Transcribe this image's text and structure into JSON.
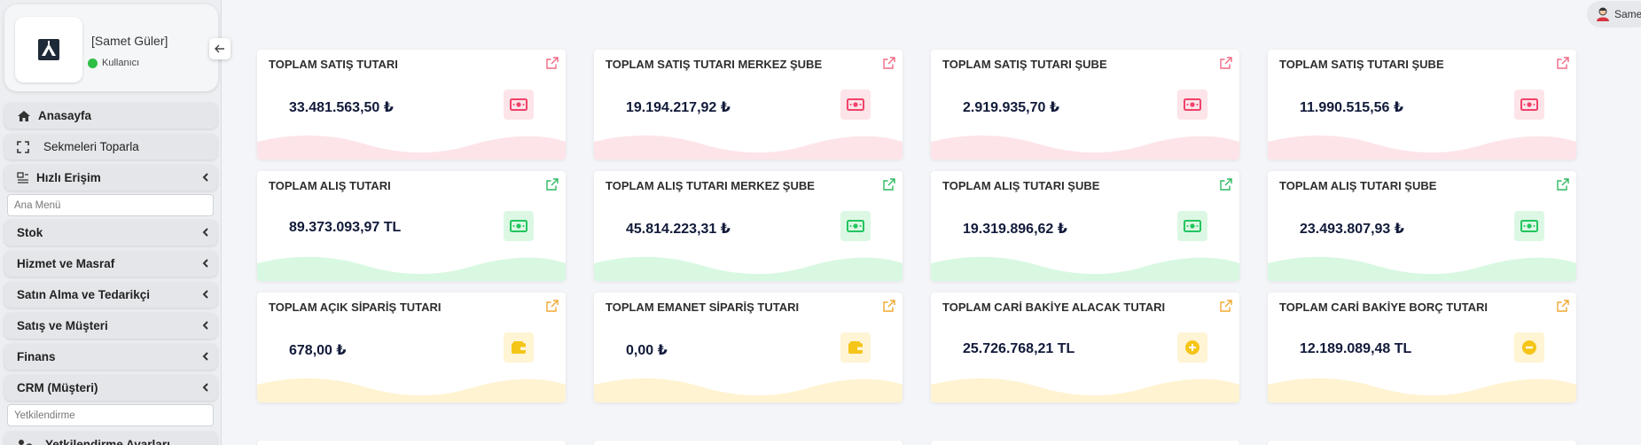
{
  "sidebar": {
    "user_name": "[Samet Güler]",
    "user_role": "Kullanıcı",
    "home_label": "Anasayfa",
    "tabs_label": "Sekmeleri Toparla",
    "quick_label": "Hızlı Erişim",
    "menu_placeholder": "Ana Menü",
    "items": [
      "Stok",
      "Hizmet ve Masraf",
      "Satın Alma ve Tedarikçi",
      "Satış ve Müşteri",
      "Finans",
      "CRM (Müşteri)"
    ],
    "auth_placeholder": "Yetkilendirme",
    "auth_settings_label": "Yetkilendirme Ayarları"
  },
  "header": {
    "user_chip": "Same"
  },
  "cards": [
    {
      "title": "TOPLAM SATIŞ TUTARI",
      "value": "33.481.563,50 ₺",
      "tone": "red",
      "icon": "cash-icon"
    },
    {
      "title": "TOPLAM SATIŞ TUTARI MERKEZ ŞUBE",
      "value": "19.194.217,92 ₺",
      "tone": "red",
      "icon": "cash-icon"
    },
    {
      "title": "TOPLAM SATIŞ TUTARI           ŞUBE",
      "value": "2.919.935,70 ₺",
      "tone": "red",
      "icon": "cash-icon"
    },
    {
      "title": "TOPLAM SATIŞ TUTARI        ŞUBE",
      "value": "11.990.515,56 ₺",
      "tone": "red",
      "icon": "cash-icon"
    },
    {
      "title": "TOPLAM ALIŞ TUTARI",
      "value": "89.373.093,97 TL",
      "tone": "green",
      "icon": "cash-icon"
    },
    {
      "title": "TOPLAM ALIŞ TUTARI MERKEZ ŞUBE",
      "value": "45.814.223,31 ₺",
      "tone": "green",
      "icon": "cash-icon"
    },
    {
      "title": "TOPLAM ALIŞ TUTARI          ŞUBE",
      "value": "19.319.896,62 ₺",
      "tone": "green",
      "icon": "cash-icon"
    },
    {
      "title": "TOPLAM ALIŞ TUTARI         ŞUBE",
      "value": "23.493.807,93 ₺",
      "tone": "green",
      "icon": "cash-icon"
    },
    {
      "title": "TOPLAM AÇIK SİPARİŞ TUTARI",
      "value": "678,00 ₺",
      "tone": "yellow",
      "icon": "wallet-icon"
    },
    {
      "title": "TOPLAM EMANET SİPARİŞ TUTARI",
      "value": "0,00 ₺",
      "tone": "yellow",
      "icon": "wallet-icon"
    },
    {
      "title": "TOPLAM CARİ BAKİYE ALACAK TUTARI",
      "value": "25.726.768,21 TL",
      "tone": "yellow",
      "icon": "plus-circle-icon"
    },
    {
      "title": "TOPLAM CARİ BAKİYE BORÇ TUTARI",
      "value": "12.189.089,48 TL",
      "tone": "yellow",
      "icon": "minus-circle-icon"
    }
  ],
  "colors": {
    "red": "#f0426a",
    "red_wave": "#fde4e9",
    "green": "#22c55e",
    "green_wave": "#d9f8e2",
    "yellow": "#f5c518",
    "yellow_wave": "#fff3d2",
    "link_red": "#ef6a85",
    "link_green": "#2fb861",
    "link_yellow": "#f0a830"
  }
}
